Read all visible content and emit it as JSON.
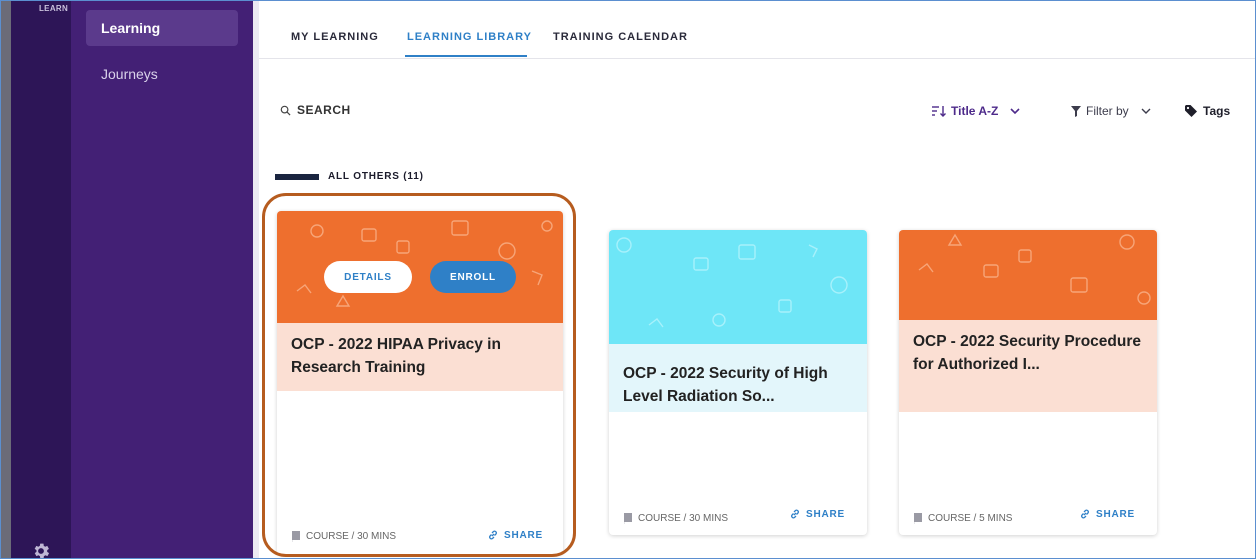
{
  "brand": {
    "logo_text": "LEARN"
  },
  "sidebar": {
    "items": [
      {
        "label": "Learning",
        "active": true
      },
      {
        "label": "Journeys",
        "active": false
      }
    ]
  },
  "tabs": [
    {
      "label": "MY LEARNING",
      "active": false
    },
    {
      "label": "LEARNING LIBRARY",
      "active": true
    },
    {
      "label": "TRAINING CALENDAR",
      "active": false
    }
  ],
  "toolbar": {
    "search_label": "SEARCH",
    "sort_label": "Title A-Z",
    "filter_label": "Filter by",
    "tags_label": "Tags"
  },
  "section": {
    "title": "ALL OTHERS (11)"
  },
  "cards": [
    {
      "title": "OCP - 2022 HIPAA Privacy in Research Training",
      "meta": "COURSE / 30 MINS",
      "share_label": "SHARE",
      "details_label": "DETAILS",
      "enroll_label": "ENROLL",
      "band_color": "#ee6f2e",
      "title_bg": "#fbdfd3"
    },
    {
      "title": "OCP - 2022 Security of High Level Radiation So...",
      "meta": "COURSE / 30 MINS",
      "share_label": "SHARE",
      "band_color": "#6ee6f7",
      "title_bg": "#e3f6fb"
    },
    {
      "title": "OCP - 2022 Security Procedure for Authorized I...",
      "meta": "COURSE / 5 MINS",
      "share_label": "SHARE",
      "band_color": "#ee6f2e",
      "title_bg": "#fbdfd3"
    }
  ],
  "colors": {
    "accent": "#2f80c7",
    "sidebar": "#432075",
    "rail": "#2d1557",
    "highlight": "#b65c1f"
  }
}
